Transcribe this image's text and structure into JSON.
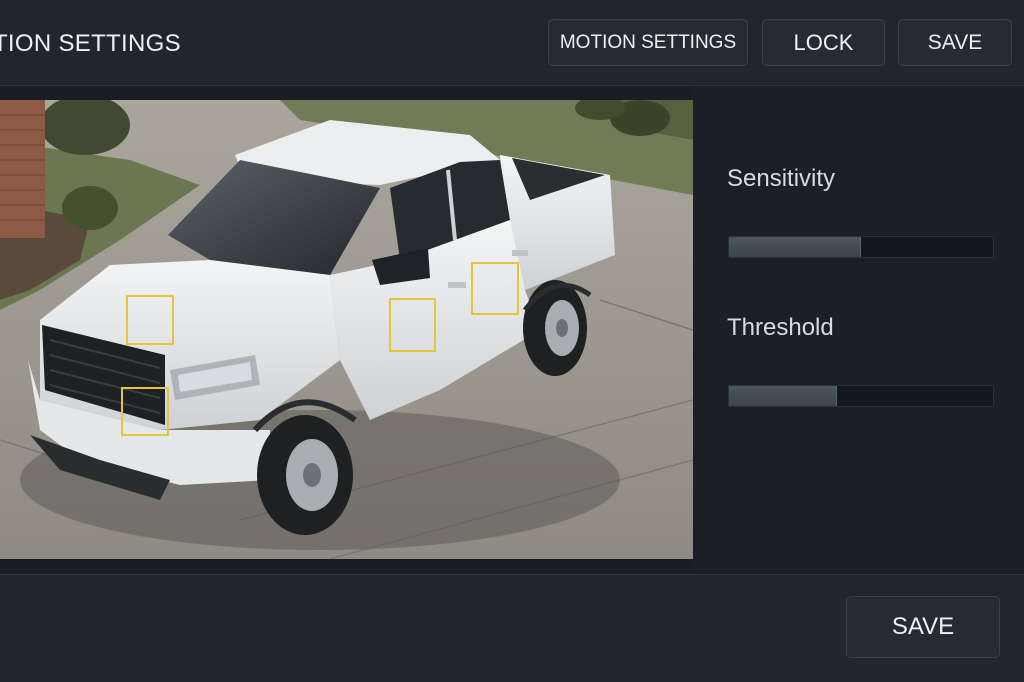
{
  "header": {
    "title": "OTION SETTINGS",
    "buttons": {
      "motion_settings": "MOTION SETTINGS",
      "lock": "LOCK",
      "save": "SAVE"
    }
  },
  "side_panel": {
    "sensitivity": {
      "label": "Sensitivity",
      "value_fraction": 0.5
    },
    "threshold": {
      "label": "Threshold",
      "value_fraction": 0.41
    }
  },
  "camera": {
    "zone_color": "#e2c63c",
    "zone_count": 4
  },
  "footer": {
    "save": "SAVE"
  },
  "colors": {
    "background": "#1b1f25",
    "panel": "#22262c",
    "accent_zone": "#e2c63c"
  }
}
